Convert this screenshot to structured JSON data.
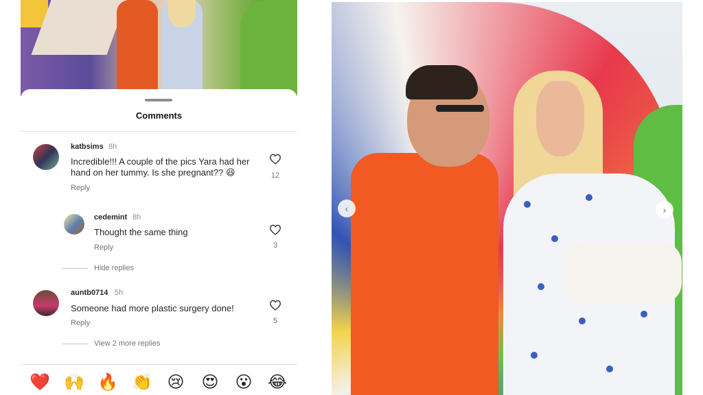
{
  "sheet": {
    "title": "Comments"
  },
  "comments": [
    {
      "username": "katbsims",
      "time": "8h",
      "text": "Incredible!!! A couple of the pics Yara had her hand on her tummy. Is she pregnant?? 😆",
      "reply_label": "Reply",
      "likes": "12"
    },
    {
      "username": "cedemint",
      "time": "8h",
      "text": "Thought the same thing",
      "reply_label": "Reply",
      "likes": "3"
    },
    {
      "username": "auntb0714",
      "time": "5h",
      "text": "Someone had more plastic surgery done!",
      "reply_label": "Reply",
      "likes": "5"
    }
  ],
  "threads": {
    "hide_replies": "Hide replies",
    "view_more": "View 2 more replies"
  },
  "reactions": [
    "❤️",
    "🙌",
    "🔥",
    "👏",
    "😢",
    "😍",
    "😮",
    "😂"
  ],
  "photo": {
    "prev_icon": "chevron-left-icon",
    "next_icon": "chevron-right-icon"
  },
  "colors": {
    "heart_outline": "#262626",
    "accent_red": "#ed4956"
  }
}
